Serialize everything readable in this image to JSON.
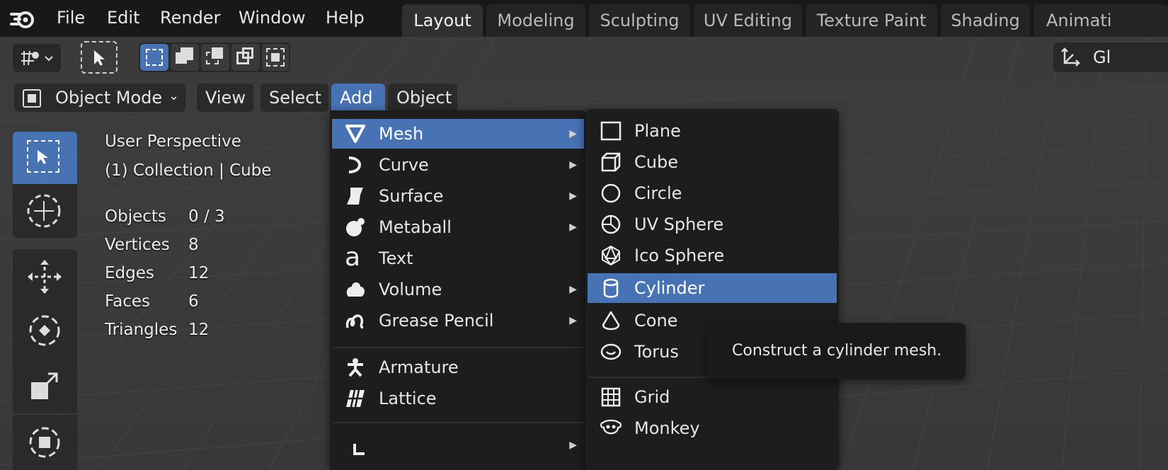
{
  "menubar": {
    "items": [
      "File",
      "Edit",
      "Render",
      "Window",
      "Help"
    ]
  },
  "workspaces": {
    "tabs": [
      "Layout",
      "Modeling",
      "Sculpting",
      "UV Editing",
      "Texture Paint",
      "Shading",
      "Animati"
    ],
    "active": "Layout"
  },
  "tool_header": {
    "orientation_label": "Gl"
  },
  "header": {
    "mode": "Object Mode",
    "menus": [
      "View",
      "Select",
      "Add",
      "Object"
    ],
    "active_menu": "Add"
  },
  "overlay": {
    "perspective": "User Perspective",
    "collection": "(1) Collection | Cube",
    "stats": [
      {
        "label": "Objects",
        "value": "0 / 3"
      },
      {
        "label": "Vertices",
        "value": "8"
      },
      {
        "label": "Edges",
        "value": "12"
      },
      {
        "label": "Faces",
        "value": "6"
      },
      {
        "label": "Triangles",
        "value": "12"
      }
    ]
  },
  "add_menu": {
    "items": [
      {
        "label": "Mesh",
        "icon": "mesh-icon",
        "submenu": true,
        "highlighted": true
      },
      {
        "label": "Curve",
        "icon": "curve-icon",
        "submenu": true
      },
      {
        "label": "Surface",
        "icon": "surface-icon",
        "submenu": true
      },
      {
        "label": "Metaball",
        "icon": "metaball-icon",
        "submenu": true
      },
      {
        "label": "Text",
        "icon": "text-icon",
        "submenu": false
      },
      {
        "label": "Volume",
        "icon": "volume-icon",
        "submenu": true
      },
      {
        "label": "Grease Pencil",
        "icon": "grease-pencil-icon",
        "submenu": true
      },
      {
        "label": "Armature",
        "icon": "armature-icon",
        "submenu": false
      },
      {
        "label": "Lattice",
        "icon": "lattice-icon",
        "submenu": false
      }
    ]
  },
  "mesh_menu": {
    "items": [
      {
        "label": "Plane",
        "icon": "plane-icon"
      },
      {
        "label": "Cube",
        "icon": "cube-icon"
      },
      {
        "label": "Circle",
        "icon": "circle-icon"
      },
      {
        "label": "UV Sphere",
        "icon": "uv-sphere-icon"
      },
      {
        "label": "Ico Sphere",
        "icon": "ico-sphere-icon"
      },
      {
        "label": "Cylinder",
        "icon": "cylinder-icon",
        "highlighted": true
      },
      {
        "label": "Cone",
        "icon": "cone-icon"
      },
      {
        "label": "Torus",
        "icon": "torus-icon"
      },
      {
        "label": "Grid",
        "icon": "grid-icon"
      },
      {
        "label": "Monkey",
        "icon": "monkey-icon"
      }
    ]
  },
  "tooltip": {
    "text": "Construct a cylinder mesh."
  },
  "colors": {
    "accent": "#4772b3",
    "menu_bg": "#1d1d1d",
    "topbar_bg": "#181818"
  }
}
